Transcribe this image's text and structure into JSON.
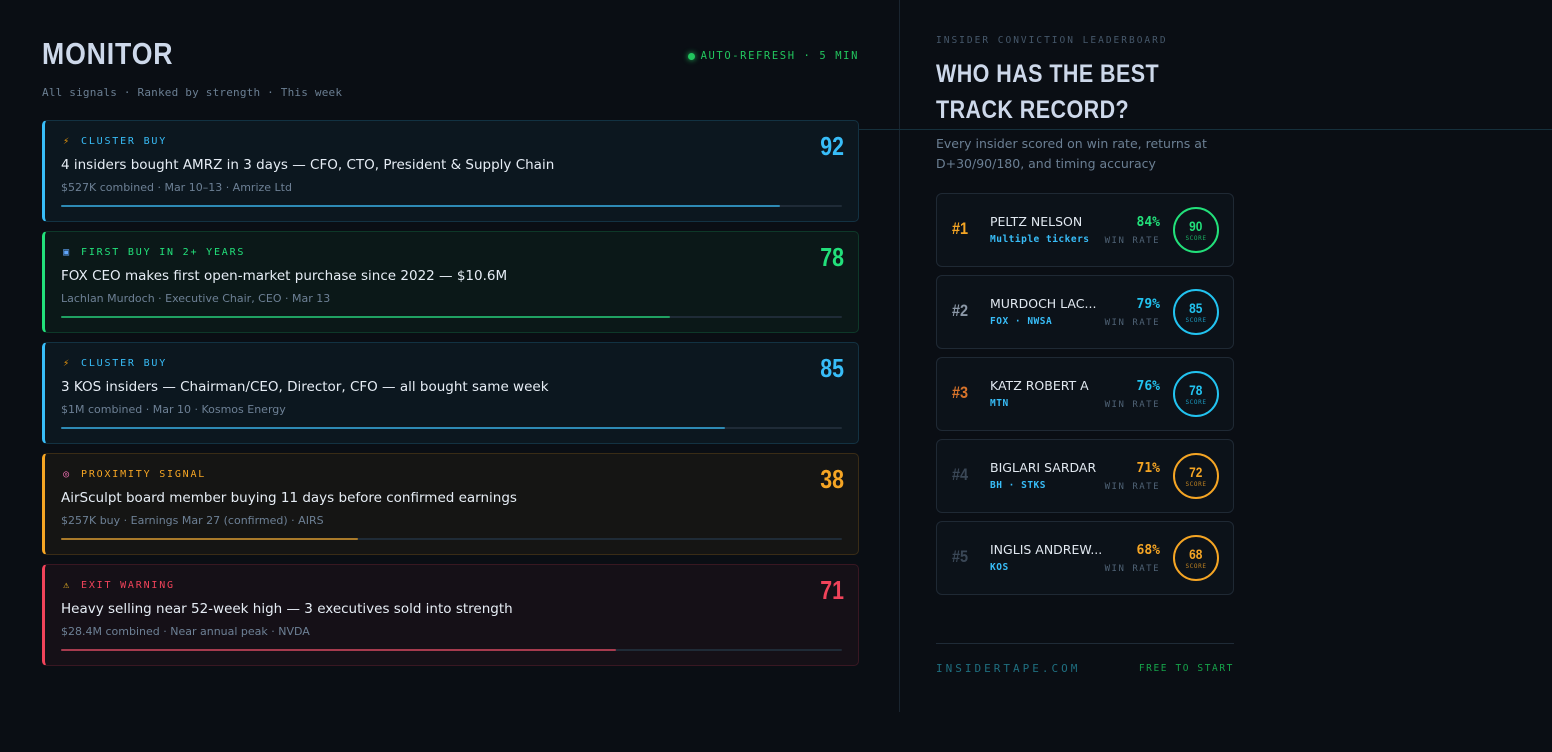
{
  "monitor": {
    "title": "MONITOR",
    "subtitle": "All signals · Ranked by strength · This week",
    "auto_refresh": "AUTO-REFRESH · 5 MIN"
  },
  "signals": [
    {
      "type": "CLUSTER BUY",
      "icon": "lightning-icon",
      "headline": "4 insiders bought AMRZ in 3 days — CFO, CTO, President & Supply Chain",
      "meta": "$527K combined · Mar 10–13 · Amrize Ltd",
      "score": "92",
      "strength": 0.92,
      "color": "#38bdf8"
    },
    {
      "type": "FIRST BUY IN 2+ YEARS",
      "icon": "new-badge-icon",
      "headline": "FOX CEO makes first open-market purchase since 2022 — $10.6M",
      "meta": "Lachlan Murdoch · Executive Chair, CEO · Mar 13",
      "score": "78",
      "strength": 0.78,
      "color": "#22e07a"
    },
    {
      "type": "CLUSTER BUY",
      "icon": "lightning-icon",
      "headline": "3 KOS insiders — Chairman/CEO, Director, CFO — all bought same week",
      "meta": "$1M combined · Mar 10 · Kosmos Energy",
      "score": "85",
      "strength": 0.85,
      "color": "#38bdf8"
    },
    {
      "type": "PROXIMITY SIGNAL",
      "icon": "target-icon",
      "headline": "AirSculpt board member buying 11 days before confirmed earnings",
      "meta": "$257K buy · Earnings Mar 27 (confirmed) · AIRS",
      "score": "38",
      "strength": 0.38,
      "color": "#f5a524"
    },
    {
      "type": "EXIT WARNING",
      "icon": "warning-icon",
      "headline": "Heavy selling near 52-week high — 3 executives sold into strength",
      "meta": "$28.4M combined · Near annual peak · NVDA",
      "score": "71",
      "strength": 0.71,
      "color": "#f0435a"
    }
  ],
  "leaderboard": {
    "eyebrow": "INSIDER CONVICTION LEADERBOARD",
    "title": "WHO HAS THE BEST TRACK RECORD?",
    "subtitle": "Every insider scored on win rate, returns at D+30/90/180, and timing accuracy",
    "win_rate_label": "WIN RATE",
    "score_label": "SCORE",
    "entries": [
      {
        "rank": "#1",
        "name": "PELTZ NELSON",
        "tickers": "Multiple tickers",
        "win_rate": "84%",
        "score": "90",
        "rank_color": "#f5a524",
        "rate_color": "#22e07a",
        "ring_color": "#22e07a"
      },
      {
        "rank": "#2",
        "name": "MURDOCH LAC...",
        "tickers": "FOX · NWSA",
        "win_rate": "79%",
        "score": "85",
        "rank_color": "#8b97a6",
        "rate_color": "#22c3f0",
        "ring_color": "#22c3f0"
      },
      {
        "rank": "#3",
        "name": "KATZ ROBERT A",
        "tickers": "MTN",
        "win_rate": "76%",
        "score": "78",
        "rank_color": "#d9742b",
        "rate_color": "#22c3f0",
        "ring_color": "#22c3f0"
      },
      {
        "rank": "#4",
        "name": "BIGLARI SARDAR",
        "tickers": "BH · STKS",
        "win_rate": "71%",
        "score": "72",
        "rank_color": "#3a4756",
        "rate_color": "#f5a524",
        "ring_color": "#f5a524"
      },
      {
        "rank": "#5",
        "name": "INGLIS ANDREW...",
        "tickers": "KOS",
        "win_rate": "68%",
        "score": "68",
        "rank_color": "#3a4756",
        "rate_color": "#f5a524",
        "ring_color": "#f5a524"
      }
    ]
  },
  "footer": {
    "brand": "INSIDERTAPE.COM",
    "cta": "FREE TO START"
  }
}
